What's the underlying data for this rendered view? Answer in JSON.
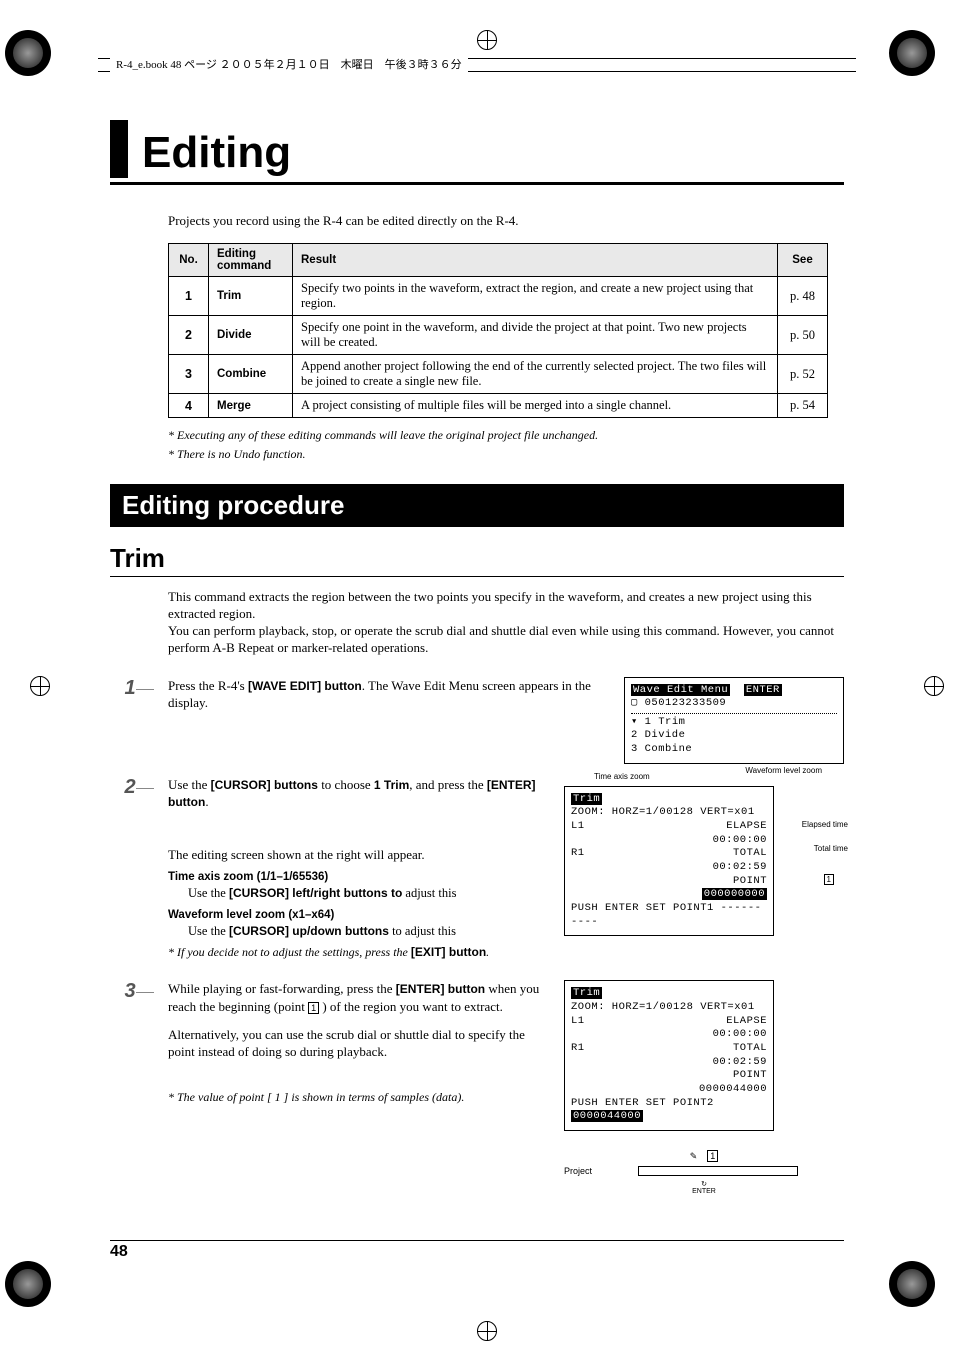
{
  "header": {
    "text": "R-4_e.book  48 ページ  ２００５年２月１０日　木曜日　午後３時３６分"
  },
  "title": "Editing",
  "intro": "Projects you record using the R-4 can be edited directly on the R-4.",
  "table": {
    "headers": {
      "no": "No.",
      "cmd": "Editing command",
      "result": "Result",
      "see": "See"
    },
    "rows": [
      {
        "no": "1",
        "cmd": "Trim",
        "result": "Specify two points in the waveform, extract the region, and create a new project using that region.",
        "see": "p. 48"
      },
      {
        "no": "2",
        "cmd": "Divide",
        "result": "Specify one point in the waveform, and divide the project at that point. Two new projects will be created.",
        "see": "p. 50"
      },
      {
        "no": "3",
        "cmd": "Combine",
        "result": "Append another project following the end of the currently selected project. The two files will be joined to create a single new file.",
        "see": "p. 52"
      },
      {
        "no": "4",
        "cmd": "Merge",
        "result": "A project consisting of multiple files will be merged into a single channel.",
        "see": "p. 54"
      }
    ]
  },
  "footnotes": [
    "*  Executing any of these editing commands will leave the original project file unchanged.",
    "*  There is no Undo function."
  ],
  "section": "Editing procedure",
  "subsection": "Trim",
  "trim_desc": [
    "This command extracts the region between the two points you specify in the waveform, and creates a new project using this extracted region.",
    "You can perform playback, stop, or operate the scrub dial and shuttle dial even while using this command. However, you cannot perform A-B Repeat or marker-related operations."
  ],
  "steps": {
    "s1": {
      "num": "1",
      "text_a": "Press the R-4's ",
      "bold_a": "[WAVE EDIT] button",
      "text_b": ". The Wave Edit Menu screen appears in the display."
    },
    "s2": {
      "num": "2",
      "text_a": "Use the ",
      "bold_a": "[CURSOR] buttons",
      "text_b": " to choose ",
      "bold_b": "1 Trim",
      "text_c": ", and press the ",
      "bold_c": "[ENTER] button",
      "text_d": ".",
      "sub_intro": "The editing screen shown at the right will appear.",
      "axis_title": "Time axis zoom (1/1–1/65536)",
      "axis_text_a": "Use the ",
      "axis_bold": "[CURSOR] left/right buttons to",
      "axis_text_b": " adjust this",
      "wf_title": "Waveform level zoom (x1–x64)",
      "wf_text_a": "Use the ",
      "wf_bold": "[CURSOR] up/down buttons",
      "wf_text_b": " to adjust this",
      "note_a": "*  If you decide not to adjust the settings, press the ",
      "note_bold": "[EXIT] button",
      "note_b": "."
    },
    "s3": {
      "num": "3",
      "text_a": "While playing or fast-forwarding, press the ",
      "bold_a": "[ENTER] button",
      "text_b": " when you reach the beginning (point ",
      "icon": "1",
      "text_c": " ) of the region you want to extract.",
      "alt": "Alternatively, you can use the scrub dial or shuttle dial to specify the point instead of doing so during playback.",
      "note": "*  The value of point [ 1 ] is shown in terms of samples (data)."
    }
  },
  "lcd1": {
    "l1a": "Wave Edit Menu",
    "l1b": "ENTER",
    "l2": "▢ 050123233509",
    "l3": "▾ 1 Trim",
    "l4": "  2 Divide",
    "l5": "  3 Combine"
  },
  "lcd2": {
    "labels": {
      "tz": "Time axis zoom",
      "wz": "Waveform level zoom",
      "et": "Elapsed time",
      "tt": "Total time"
    },
    "title": "Trim",
    "zoom": "ZOOM:  HORZ=1/00128  VERT=x01",
    "l1": "L1",
    "elapse": "ELAPSE",
    "etime": "00:00:00",
    "r1": "R1",
    "total": "TOTAL",
    "ttime": "00:02:59",
    "point": "POINT",
    "pval": "000000000",
    "foot": "PUSH ENTER SET POINT1  ----------",
    "marker": "1"
  },
  "lcd3": {
    "title": "Trim",
    "zoom": "ZOOM:  HORZ=1/00128  VERT=x01",
    "l1": "L1",
    "elapse": "ELAPSE",
    "etime": "00:00:00",
    "r1": "R1",
    "total": "TOTAL",
    "ttime": "00:02:59",
    "point": "POINT",
    "pval": "0000044000",
    "foot_a": "PUSH ENTER SET POINT2",
    "foot_b": "0000044000"
  },
  "diagram": {
    "project": "Project",
    "enter": "ENTER",
    "icon": "1"
  },
  "pagenum": "48"
}
